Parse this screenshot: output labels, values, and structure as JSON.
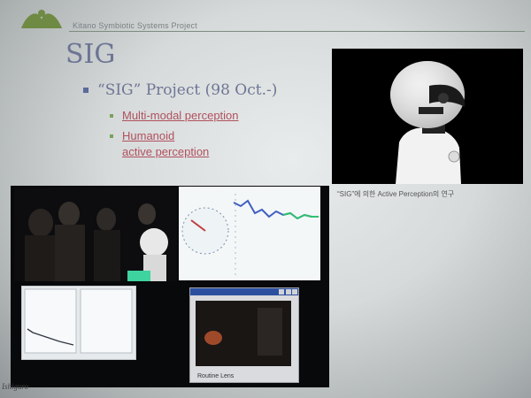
{
  "header": {
    "title": "Kitano Symbiotic Systems Project",
    "logo_icon": "kitano-logo-icon"
  },
  "slide": {
    "title": "SIG",
    "main_bullet": {
      "text": "“SIG” Project",
      "paren": "(98 Oct.-)"
    },
    "sub_bullets": [
      {
        "lines": [
          "Multi-modal perception"
        ]
      },
      {
        "lines": [
          "Humanoid",
          "active perception"
        ]
      }
    ]
  },
  "robot_photo": {
    "caption": "“SIG”에 의한 Active Perception의 연구",
    "icon": "robot-head-icon"
  },
  "video_collage": {
    "cam_status": "Routine Lens",
    "icons": [
      "people-photo-icon",
      "graph-plot-icon",
      "camera-window-icon"
    ]
  },
  "footer": {
    "mark": "Ishiguro"
  },
  "colors": {
    "title_blue": "#6d7594",
    "link_red": "#b0505e",
    "bullet_green": "#7ba25a",
    "rule_green": "#7d8c80"
  }
}
